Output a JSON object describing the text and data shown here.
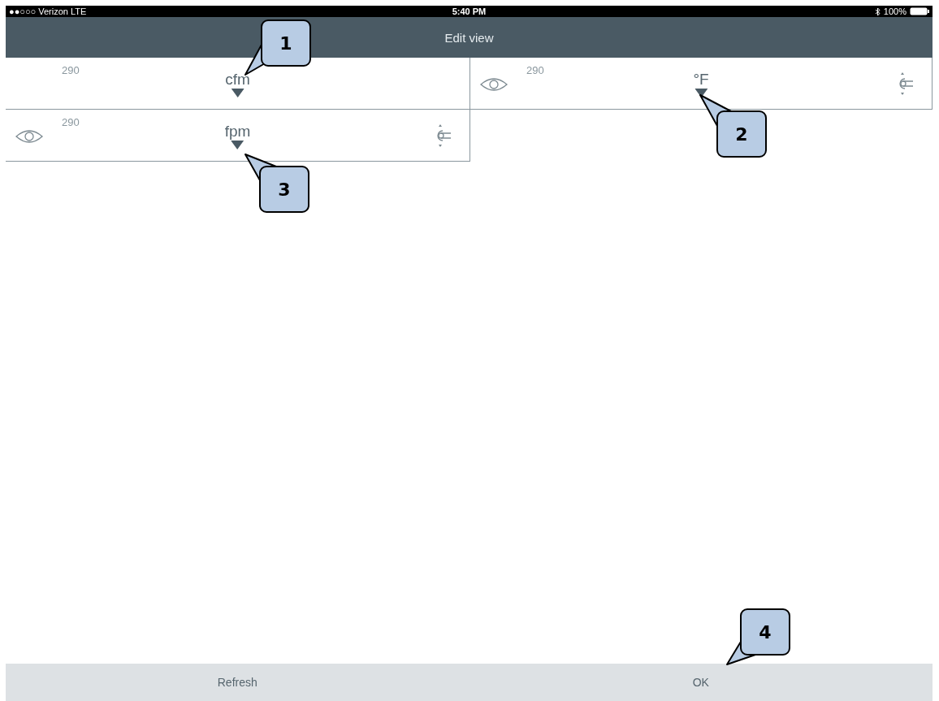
{
  "status_bar": {
    "carrier": "●●○○○ Verizon  LTE",
    "time": "5:40 PM",
    "battery": "100%"
  },
  "title_bar": {
    "title": "Edit view"
  },
  "tiles": [
    {
      "value": "290",
      "unit": "cfm",
      "icons_visible": false
    },
    {
      "value": "290",
      "unit": "°F",
      "icons_visible": true
    },
    {
      "value": "290",
      "unit": "fpm",
      "icons_visible": true
    }
  ],
  "bottom_bar": {
    "buttons": [
      "Refresh",
      "OK"
    ]
  },
  "callouts": [
    "1",
    "2",
    "3",
    "4"
  ]
}
